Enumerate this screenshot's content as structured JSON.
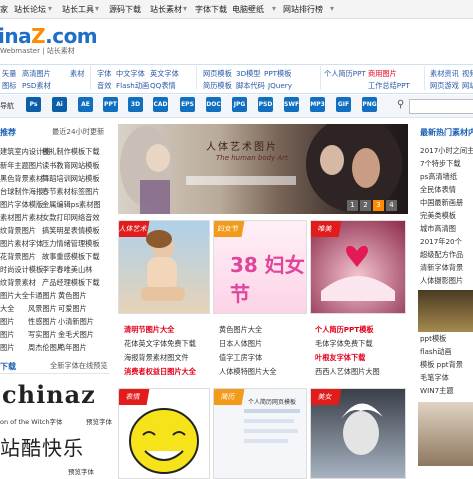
{
  "topnav": [
    "家",
    "站长论坛",
    "站长工具",
    "源码下载",
    "站长素材",
    "字体下载",
    "电脑壁纸",
    "网站排行榜"
  ],
  "logo": {
    "text_a": "ina",
    "text_z": "Z",
    "text_b": ".com",
    "sub": "Webmaster | 站长素材"
  },
  "categories": {
    "row1": [
      "矢量",
      "高清图片",
      "素材",
      "字体",
      "中文字体",
      "英文字体",
      "网页模板",
      "3D模型",
      "PPT模板",
      "个人简历PPT",
      "商用图片",
      "素材资讯",
      "视频"
    ],
    "row2": [
      "图标",
      "PSD素材",
      "",
      "音效",
      "Flash动画",
      "QQ表情",
      "简历模板",
      "脚本代码",
      "JQuery",
      "工作总结PPT",
      "",
      "网页游戏",
      "网站"
    ]
  },
  "toolbar": {
    "first_label": "导航",
    "icons": [
      "Ps",
      "Ai",
      "AE",
      "PPT",
      "3D",
      "CAD",
      "EPS",
      "DOC",
      "JPG",
      "PSD",
      "SWF",
      "MP3",
      "GIF",
      "PNG"
    ]
  },
  "left": {
    "head1": "推荐",
    "head1_right": "最近24小时更新",
    "rows": [
      [
        "建筑室内设计图",
        "模礼制作模板下载"
      ],
      [
        "新年主题图片",
        "读书教育网站模板"
      ],
      [
        "黑色背景素材",
        "舞蹈培训网站模板"
      ],
      [
        "台球制作海报",
        "春节素材标签图片"
      ],
      [
        "图片字体模版",
        "金属编辑ps素材图"
      ],
      [
        "素材图片素材",
        "女款打印网络音效"
      ],
      [
        "纹背景图片",
        "搞笑明星表情模板"
      ],
      [
        "图片素材字体",
        "压力情绪管理模板"
      ],
      [
        "花背景图片",
        "故事重感模板下载"
      ],
      [
        "时尚设计模板",
        "李宇春唯美山林"
      ],
      [
        "纹背景素材",
        "产品经理模板下载"
      ],
      [
        "图片大全",
        "卡通图片",
        "黄色图片"
      ],
      [
        "大全",
        "风景图片",
        "可爱图片"
      ],
      [
        "图片",
        "性感图片",
        "小清新图片"
      ],
      [
        "图片",
        "写实图片",
        "金毛犬图片"
      ],
      [
        "图片",
        "周杰伦图片",
        "鸡年图片"
      ]
    ],
    "head2": "下载",
    "head2_right": "全新字体在线预览",
    "font_sample1": "chinaz",
    "font_sample1_label": "on of the Witch字体",
    "font_sample1_link": "预览字体",
    "font_sample2": "站酷快乐",
    "font_sample2_link": "预览字体"
  },
  "banner": {
    "title": "人体艺术图片",
    "subtitle": "The human body Art",
    "pages": [
      "1",
      "2",
      "3",
      "4"
    ],
    "active": 2
  },
  "thumbs": {
    "ribbons": [
      "人体艺术",
      "妇女节",
      "唯美",
      "表情",
      "简历",
      "美女"
    ],
    "row1_text": "38 妇女节",
    "lists": [
      [
        "清明节图片大全",
        "花体英文字体免费下载",
        "海报背景素材图文件",
        "消费者权益日图片大全"
      ],
      [
        "黄色图片大全",
        "日本人体图片",
        "值字工房字体",
        "人体模特图片大全"
      ],
      [
        "个人简历PPT模板",
        "毛体字体免费下载",
        "叶根友字体下载",
        "西西人艺体图片大图"
      ]
    ],
    "resume_text": "个人简历网页模板"
  },
  "right": {
    "head": "最新热门素材内容",
    "rows": [
      "2017小时之间主题",
      "7个特步下载",
      "ps高清墙纸",
      "全民体表情",
      "中国最新画册",
      "完美类模板",
      "城市高清图",
      "2017年20个",
      "超级配方作品",
      "清新字体背景",
      "人体摄影图片"
    ],
    "bottom": [
      "ppt模板",
      "flash动画",
      "模板 ppt背景",
      "毛笔字体",
      "WIN7主题"
    ]
  }
}
